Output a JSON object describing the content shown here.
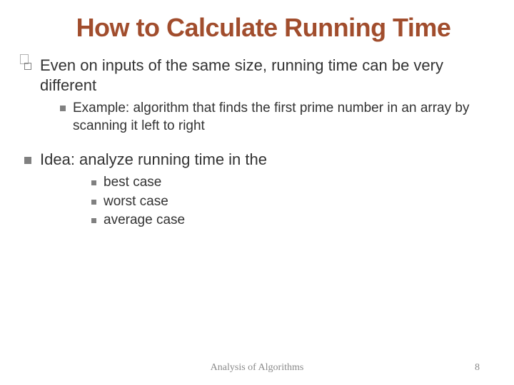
{
  "title": "How to Calculate Running Time",
  "bullets": {
    "p1": {
      "text": "Even on inputs of the same size, running time can be very different",
      "sub": [
        "Example: algorithm that finds the first prime number in an array by scanning it left to right"
      ]
    },
    "p2": {
      "text": "Idea: analyze running time in the",
      "sub": [
        "best case",
        "worst case",
        "average case"
      ]
    }
  },
  "footer": "Analysis of Algorithms",
  "page_number": "8"
}
